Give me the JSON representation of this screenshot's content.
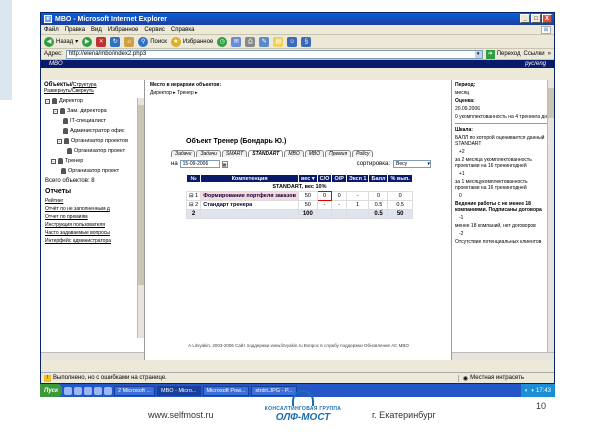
{
  "window": {
    "title": "MBO - Microsoft Internet Explorer",
    "controls": [
      "_",
      "□",
      "X"
    ]
  },
  "menu": [
    "Файл",
    "Правка",
    "Вид",
    "Избранное",
    "Сервис",
    "Справка"
  ],
  "toolbar": {
    "back": "Назад",
    "search": "Поиск",
    "favorites": "Избранное"
  },
  "address": {
    "label": "Адрес:",
    "url": "http://elena/mbo/index2.php3",
    "go": "Переход",
    "links": "Ссылки"
  },
  "app": {
    "left": "MBO",
    "right": "рус/eng"
  },
  "left": {
    "header": "Объекты/",
    "link_structure": "Структура",
    "link_dev": "Развернуть/Свернуть",
    "tree": [
      {
        "label": "Директор",
        "level": 0
      },
      {
        "label": "Зам. директора",
        "level": 1
      },
      {
        "label": "IT-специалист",
        "level": 2
      },
      {
        "label": "Администратор офис",
        "level": 2
      },
      {
        "label": "Организатор проектов",
        "level": 2
      },
      {
        "label": "Организатор проект",
        "level": 3
      },
      {
        "label": "Тренер",
        "level": 1
      },
      {
        "label": "Организатор проект",
        "level": 2
      }
    ],
    "total": "Всего объектов: 8",
    "reports_title": "Отчеты",
    "reports": [
      "Рейтинг",
      "Отчёт по не заполненным д",
      "Отчет по премиям",
      "Инструкция пользователя",
      "Часто задаваемые вопросы",
      "Интерфейс администратора"
    ]
  },
  "main": {
    "place_title": "Место в иерархии объектов:",
    "breadcrumb": "Директор ▸ Тренер ▸",
    "object_title": "Объект  Тренер (Бондарь Ю.)",
    "tabs": [
      "Задачи",
      "Задачи",
      "SMART",
      "STANDART",
      "MBO",
      "MBO",
      "Премия",
      "Policy"
    ],
    "date_label": "на",
    "date_value": "15-09-2006",
    "sort_label": "сортировка:",
    "sort_value": "Весу",
    "table": {
      "headers": [
        "№",
        "Компетенция",
        "вес ▾",
        "С/О",
        "О/Р",
        "Эксп 1",
        "Балл",
        "% вып."
      ],
      "group": "STANDART, вес 10%",
      "rows": [
        {
          "n": "1",
          "comp": "Формирование портфеля заказов",
          "w": "50",
          "so": "0",
          "or": "0",
          "e": "-",
          "b": "0",
          "p": "0"
        },
        {
          "n": "2",
          "comp": "Стандарт тренера",
          "w": "50",
          "so": "-",
          "or": "-",
          "e": "1",
          "b": "0.5",
          "p": "0.5"
        }
      ],
      "total": {
        "n": "2",
        "w": "100",
        "b": "0.5",
        "p": "50"
      }
    },
    "footer": "A.Litvyakin, 2003-2006    Сайт поддержки www.litvyakin.ru    Вопрос в службу поддержки    Обновление АС MBO"
  },
  "right": {
    "lines": [
      {
        "t": "Период:",
        "bold": true
      },
      {
        "t": "месяц",
        "bold": false
      },
      {
        "t": "Оценка:",
        "bold": true
      },
      {
        "t": "20.09.2006",
        "bold": false
      },
      {
        "t": "0  укомплектованность на 4 тренинга дне",
        "bold": false
      }
    ],
    "scale_title": "Шкала:",
    "scale_sub": "БАЛЛ по которой оценивается данный STANDART",
    "scale": [
      {
        "v": "+2",
        "t": "за 2 месяца укомплектованность проектами на 16 тренингодней"
      },
      {
        "v": "+1",
        "t": "за 1 месяцукомплектованность проектами на 16 тренингодней"
      },
      {
        "v": "0",
        "t": "Ведение работы с не менее 18 компаниями. Подписаны договора"
      },
      {
        "v": "-1",
        "t": "менее 18 компаний, нет договоров"
      },
      {
        "v": "-2",
        "t": "Отсутствие потенциальных клиентов"
      }
    ]
  },
  "status": {
    "text": "Выполнено, но с ошибками на странице.",
    "zone": "Местная интрасеть"
  },
  "taskbar": {
    "start": "Пуск",
    "tasks": [
      "2 Microsoft ...",
      "MBO - Micro...",
      "Microsoft Pow...",
      "strdrt.JPG - P..."
    ],
    "time": "17:43"
  },
  "slide": {
    "site": "www.selfmost.ru",
    "logo_line1": "КОНСАЛТИНГОВАЯ ГРУППА",
    "logo_line2": "ОЛФ-МОСТ",
    "city": "г. Екатеринбург",
    "page": "10"
  }
}
